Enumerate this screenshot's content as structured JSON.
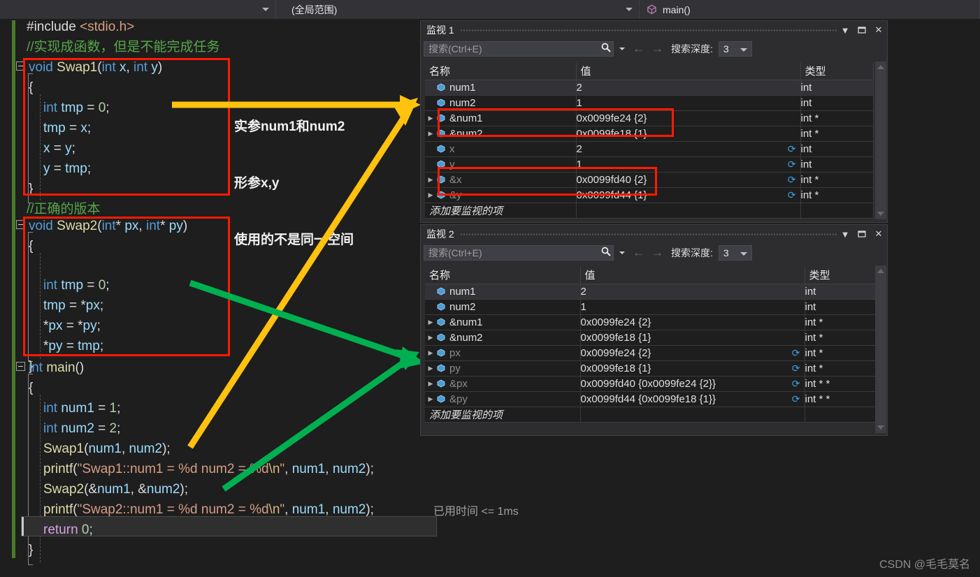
{
  "navbar": {
    "project_scope": "",
    "scope": "(全局范围)",
    "method": "main()",
    "method_icon": "method-cube-icon"
  },
  "editor": {
    "lines": [
      {
        "text": "#include <stdio.h>",
        "kind": "include"
      },
      {
        "text": "//实现成函数，但是不能完成任务",
        "kind": "comment"
      },
      {
        "text": "void Swap1(int x, int y)",
        "kind": "sig1"
      },
      {
        "text": "{",
        "kind": "brace"
      },
      {
        "text": "int tmp = 0;",
        "kind": "decl_tmp"
      },
      {
        "text": "tmp = x;",
        "kind": "assign_tmp_x"
      },
      {
        "text": "x = y;",
        "kind": "assign_x_y"
      },
      {
        "text": "y = tmp;",
        "kind": "assign_y_tmp"
      },
      {
        "text": "}",
        "kind": "brace"
      },
      {
        "text": "//正确的版本",
        "kind": "comment"
      },
      {
        "text": "void Swap2(int* px, int* py)",
        "kind": "sig2"
      },
      {
        "text": "{",
        "kind": "brace"
      },
      {
        "text": "int tmp = 0;",
        "kind": "decl_tmp"
      },
      {
        "text": "tmp = *px;",
        "kind": "assign_tmp_px"
      },
      {
        "text": "*px = *py;",
        "kind": "assign_px_py"
      },
      {
        "text": "*py = tmp;",
        "kind": "assign_py_tmp"
      },
      {
        "text": "}",
        "kind": "brace"
      },
      {
        "text": "int main()",
        "kind": "main_sig"
      },
      {
        "text": "{",
        "kind": "brace"
      },
      {
        "text": "int num1 = 1;",
        "kind": "decl_num1"
      },
      {
        "text": "int num2 = 2;",
        "kind": "decl_num2"
      },
      {
        "text": "Swap1(num1, num2);",
        "kind": "call_swap1"
      },
      {
        "text": "printf(\"Swap1::num1 = %d num2 = %d\\n\", num1, num2);",
        "kind": "printf1"
      },
      {
        "text": "Swap2(&num1, &num2);",
        "kind": "call_swap2"
      },
      {
        "text": "printf(\"Swap2::num1 = %d num2 = %d\\n\", num1, num2);",
        "kind": "printf2"
      },
      {
        "text": "return 0;",
        "kind": "ret"
      },
      {
        "text": "}",
        "kind": "brace"
      }
    ],
    "tokens": {
      "include_hash": "#include ",
      "include_file": "<stdio.h>",
      "comment1": "//实现成函数，但是不能完成任务",
      "comment2": "//正确的版本",
      "kw_void": "void",
      "kw_int": "int",
      "kw_return": "return",
      "fn_swap1": "Swap1",
      "fn_swap2": "Swap2",
      "fn_main": "main",
      "fn_printf": "printf",
      "var_x": "x",
      "var_y": "y",
      "var_tmp": "tmp",
      "var_px": "px",
      "var_py": "py",
      "var_num1": "num1",
      "var_num2": "num2",
      "num_0": "0",
      "num_1": "1",
      "num_2": "2",
      "str_swap1": "\"Swap1::num1 = %d num2 = %d",
      "str_swap2": "\"Swap2::num1 = %d num2 = %d",
      "esc_n": "\\n",
      "quote": "\"",
      "open_brace": "{",
      "close_brace": "}"
    },
    "elapsed_time": "已用时间 <= 1ms"
  },
  "annotations": {
    "note_lines": [
      "实参num1和num2",
      "形参x,y",
      "使用的不是同一空间"
    ],
    "arrow_yellow_color": "#ffc20e",
    "arrow_green_color": "#00b050",
    "box_color": "#ff1a00"
  },
  "watch1": {
    "title": "监视 1",
    "buttons": {
      "dropdown": "chevron-down-icon",
      "maximize": "maximize-icon",
      "close": "close-icon"
    },
    "search": {
      "placeholder": "搜索(Ctrl+E)",
      "value": "",
      "icon": "search-icon",
      "prev": "arrow-left-icon",
      "next": "arrow-right-icon",
      "depth_label": "搜索深度:",
      "depth_value": "3"
    },
    "columns": [
      "名称",
      "值",
      "类型"
    ],
    "rows": [
      {
        "expander": false,
        "name": "num1",
        "value": "2",
        "type": "int",
        "stale": false,
        "selected": true,
        "refresh": false,
        "boxed": false
      },
      {
        "expander": false,
        "name": "num2",
        "value": "1",
        "type": "int",
        "stale": false,
        "selected": false,
        "refresh": false,
        "boxed": false
      },
      {
        "expander": true,
        "name": "&num1",
        "value": "0x0099fe24 {2}",
        "type": "int *",
        "stale": false,
        "selected": false,
        "refresh": false,
        "boxed": true
      },
      {
        "expander": true,
        "name": "&num2",
        "value": "0x0099fe18 {1}",
        "type": "int *",
        "stale": false,
        "selected": false,
        "refresh": false,
        "boxed": true
      },
      {
        "expander": false,
        "name": "x",
        "value": "2",
        "type": "int",
        "stale": true,
        "selected": false,
        "refresh": true,
        "boxed": false
      },
      {
        "expander": false,
        "name": "y",
        "value": "1",
        "type": "int",
        "stale": true,
        "selected": false,
        "refresh": true,
        "boxed": false
      },
      {
        "expander": true,
        "name": "&x",
        "value": "0x0099fd40 {2}",
        "type": "int *",
        "stale": true,
        "selected": false,
        "refresh": true,
        "boxed": true
      },
      {
        "expander": true,
        "name": "&y",
        "value": "0x0099fd44 {1}",
        "type": "int *",
        "stale": true,
        "selected": false,
        "refresh": true,
        "boxed": true
      }
    ],
    "add_row_placeholder": "添加要监视的项"
  },
  "watch2": {
    "title": "监视 2",
    "buttons": {
      "dropdown": "chevron-down-icon",
      "maximize": "maximize-icon",
      "close": "close-icon"
    },
    "search": {
      "placeholder": "搜索(Ctrl+E)",
      "value": "",
      "icon": "search-icon",
      "prev": "arrow-left-icon",
      "next": "arrow-right-icon",
      "depth_label": "搜索深度:",
      "depth_value": "3"
    },
    "columns": [
      "名称",
      "值",
      "类型"
    ],
    "rows": [
      {
        "expander": false,
        "name": "num1",
        "value": "2",
        "type": "int",
        "stale": false,
        "selected": true,
        "refresh": false
      },
      {
        "expander": false,
        "name": "num2",
        "value": "1",
        "type": "int",
        "stale": false,
        "selected": false,
        "refresh": false
      },
      {
        "expander": true,
        "name": "&num1",
        "value": "0x0099fe24 {2}",
        "type": "int *",
        "stale": false,
        "selected": false,
        "refresh": false
      },
      {
        "expander": true,
        "name": "&num2",
        "value": "0x0099fe18 {1}",
        "type": "int *",
        "stale": false,
        "selected": false,
        "refresh": false
      },
      {
        "expander": true,
        "name": "px",
        "value": "0x0099fe24 {2}",
        "type": "int *",
        "stale": true,
        "selected": false,
        "refresh": true
      },
      {
        "expander": true,
        "name": "py",
        "value": "0x0099fe18 {1}",
        "type": "int *",
        "stale": true,
        "selected": false,
        "refresh": true
      },
      {
        "expander": true,
        "name": "&px",
        "value": "0x0099fd40 {0x0099fe24 {2}}",
        "type": "int * *",
        "stale": true,
        "selected": false,
        "refresh": true
      },
      {
        "expander": true,
        "name": "&py",
        "value": "0x0099fd44 {0x0099fe18 {1}}",
        "type": "int * *",
        "stale": true,
        "selected": false,
        "refresh": true
      }
    ],
    "add_row_placeholder": "添加要监视的项"
  },
  "watermark": "CSDN @毛毛莫名"
}
